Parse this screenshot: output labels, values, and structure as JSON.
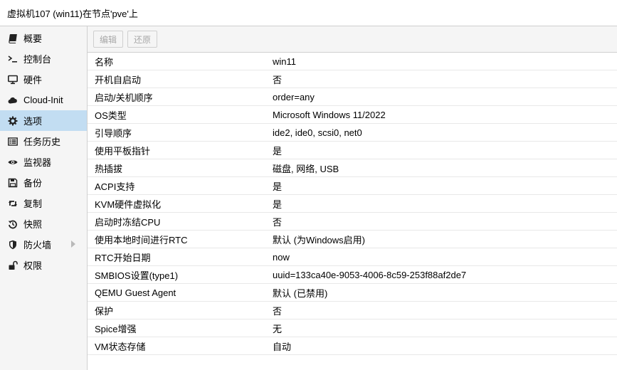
{
  "header": {
    "title": "虚拟机107 (win11)在节点'pve'上"
  },
  "sidebar": {
    "items": [
      {
        "label": "概要",
        "icon": "book-icon"
      },
      {
        "label": "控制台",
        "icon": "terminal-icon"
      },
      {
        "label": "硬件",
        "icon": "desktop-icon"
      },
      {
        "label": "Cloud-Init",
        "icon": "cloud-icon"
      },
      {
        "label": "选项",
        "icon": "gear-icon",
        "active": true
      },
      {
        "label": "任务历史",
        "icon": "list-icon"
      },
      {
        "label": "监视器",
        "icon": "eye-icon"
      },
      {
        "label": "备份",
        "icon": "floppy-icon"
      },
      {
        "label": "复制",
        "icon": "retweet-icon"
      },
      {
        "label": "快照",
        "icon": "history-icon"
      },
      {
        "label": "防火墙",
        "icon": "shield-icon",
        "has_submenu": true
      },
      {
        "label": "权限",
        "icon": "unlock-icon"
      }
    ]
  },
  "toolbar": {
    "edit_label": "编辑",
    "revert_label": "还原"
  },
  "options": [
    {
      "key": "名称",
      "value": "win11"
    },
    {
      "key": "开机自启动",
      "value": "否"
    },
    {
      "key": "启动/关机顺序",
      "value": "order=any"
    },
    {
      "key": "OS类型",
      "value": "Microsoft Windows 11/2022"
    },
    {
      "key": "引导顺序",
      "value": "ide2, ide0, scsi0, net0"
    },
    {
      "key": "使用平板指针",
      "value": "是"
    },
    {
      "key": "热插拔",
      "value": "磁盘, 网络, USB"
    },
    {
      "key": "ACPI支持",
      "value": "是"
    },
    {
      "key": "KVM硬件虚拟化",
      "value": "是"
    },
    {
      "key": "启动时冻结CPU",
      "value": "否"
    },
    {
      "key": "使用本地时间进行RTC",
      "value": "默认 (为Windows启用)"
    },
    {
      "key": "RTC开始日期",
      "value": "now"
    },
    {
      "key": "SMBIOS设置(type1)",
      "value": "uuid=133ca40e-9053-4006-8c59-253f88af2de7"
    },
    {
      "key": "QEMU Guest Agent",
      "value": "默认 (已禁用)"
    },
    {
      "key": "保护",
      "value": "否"
    },
    {
      "key": "Spice增强",
      "value": "无"
    },
    {
      "key": "VM状态存储",
      "value": "自动"
    }
  ],
  "colors": {
    "active_bg": "#c2ddf2",
    "sidebar_bg": "#f5f5f5",
    "disabled_text": "#a8a8a8"
  }
}
